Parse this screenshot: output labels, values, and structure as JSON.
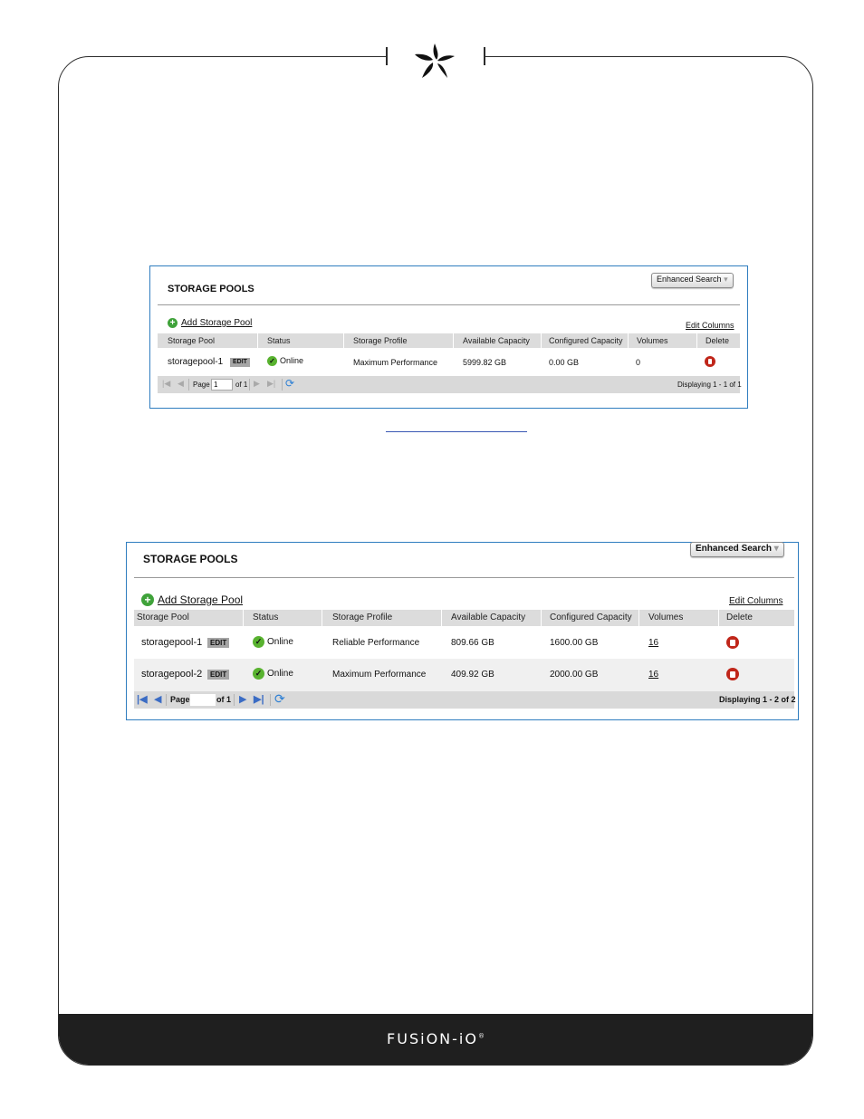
{
  "footer": {
    "brand": "FUSiON-iO",
    "trademark": "®"
  },
  "colors": {
    "panel_border": "#2f7dbf",
    "header_bg": "#dcdcdc",
    "link_blue": "#2a52a8",
    "online_green": "#58b22f",
    "delete_red": "#c0261a",
    "footer_bg": "#1f1f1f"
  },
  "icons": {
    "logo": "star-logo",
    "add": "plus-circle-icon",
    "status": "check-circle-icon",
    "delete": "trash-icon",
    "first": "first-page-icon",
    "prev": "prev-page-icon",
    "next": "next-page-icon",
    "last": "last-page-icon",
    "refresh": "refresh-icon"
  },
  "panel1": {
    "title": "STORAGE POOLS",
    "enhanced_search": "Enhanced Search",
    "add_label": "Add Storage Pool",
    "edit_columns": "Edit Columns",
    "columns": [
      "Storage Pool",
      "Status",
      "Storage Profile",
      "Available Capacity",
      "Configured Capacity",
      "Volumes",
      "Delete"
    ],
    "rows": [
      {
        "name": "storagepool-1",
        "edit": "EDIT",
        "status": "Online",
        "profile": "Maximum Performance",
        "available": "5999.82 GB",
        "configured": "0.00 GB",
        "volumes": "0"
      }
    ],
    "pager": {
      "page_label": "Page",
      "page_value": "1",
      "of_label": "of 1",
      "display": "Displaying 1 - 1 of 1"
    }
  },
  "panel2": {
    "title": "STORAGE POOLS",
    "enhanced_search": "Enhanced Search",
    "add_label": "Add Storage Pool",
    "edit_columns": "Edit Columns",
    "columns": [
      "Storage Pool",
      "Status",
      "Storage Profile",
      "Available Capacity",
      "Configured Capacity",
      "Volumes",
      "Delete"
    ],
    "rows": [
      {
        "name": "storagepool-1",
        "edit": "EDIT",
        "status": "Online",
        "profile": "Reliable Performance",
        "available": "809.66 GB",
        "configured": "1600.00 GB",
        "volumes": "16"
      },
      {
        "name": "storagepool-2",
        "edit": "EDIT",
        "status": "Online",
        "profile": "Maximum Performance",
        "available": "409.92 GB",
        "configured": "2000.00 GB",
        "volumes": "16"
      }
    ],
    "pager": {
      "page_label": "Page 1",
      "page_value": "",
      "of_label": "of 1",
      "display": "Displaying 1 - 2 of 2"
    }
  }
}
